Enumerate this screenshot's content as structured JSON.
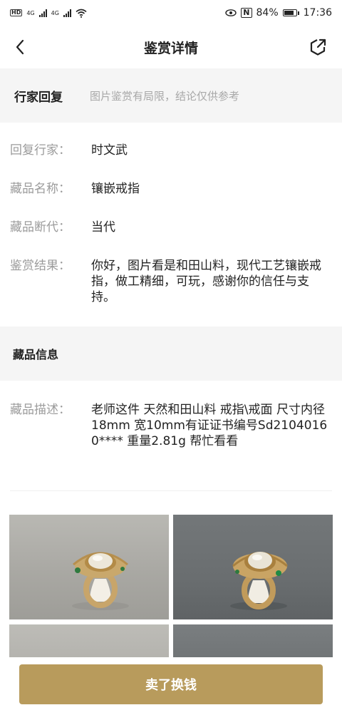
{
  "status_bar": {
    "hd1": "HD",
    "net1": "4G",
    "hd2": "HD",
    "net2": "4G",
    "battery_percent": "84%",
    "time": "17:36",
    "nfc": "N"
  },
  "nav": {
    "title": "鉴赏详情"
  },
  "reply": {
    "heading": "行家回复",
    "note": "图片鉴赏有局限，结论仅供参考",
    "fields": [
      {
        "label": "回复行家：",
        "value": "时文武"
      },
      {
        "label": "藏品名称：",
        "value": "镶嵌戒指"
      },
      {
        "label": "藏品断代：",
        "value": "当代"
      },
      {
        "label": "鉴赏结果：",
        "value": "你好，图片看是和田山料，现代工艺镶嵌戒指，做工精细，可玩，感谢你的信任与支持。"
      }
    ]
  },
  "info": {
    "heading": "藏品信息",
    "description_label": "藏品描述：",
    "description": "老师这件 天然和田山料 戒指\\戒面 尺寸内径18mm 宽10mm有证证书编号Sd21040160**** 重量2.81g 帮忙看看"
  },
  "colors": {
    "accent": "#b89b5c",
    "section_bg": "#f5f5f5",
    "label_gray": "#9b9b9b"
  },
  "actions": {
    "sell_label": "卖了换钱"
  }
}
